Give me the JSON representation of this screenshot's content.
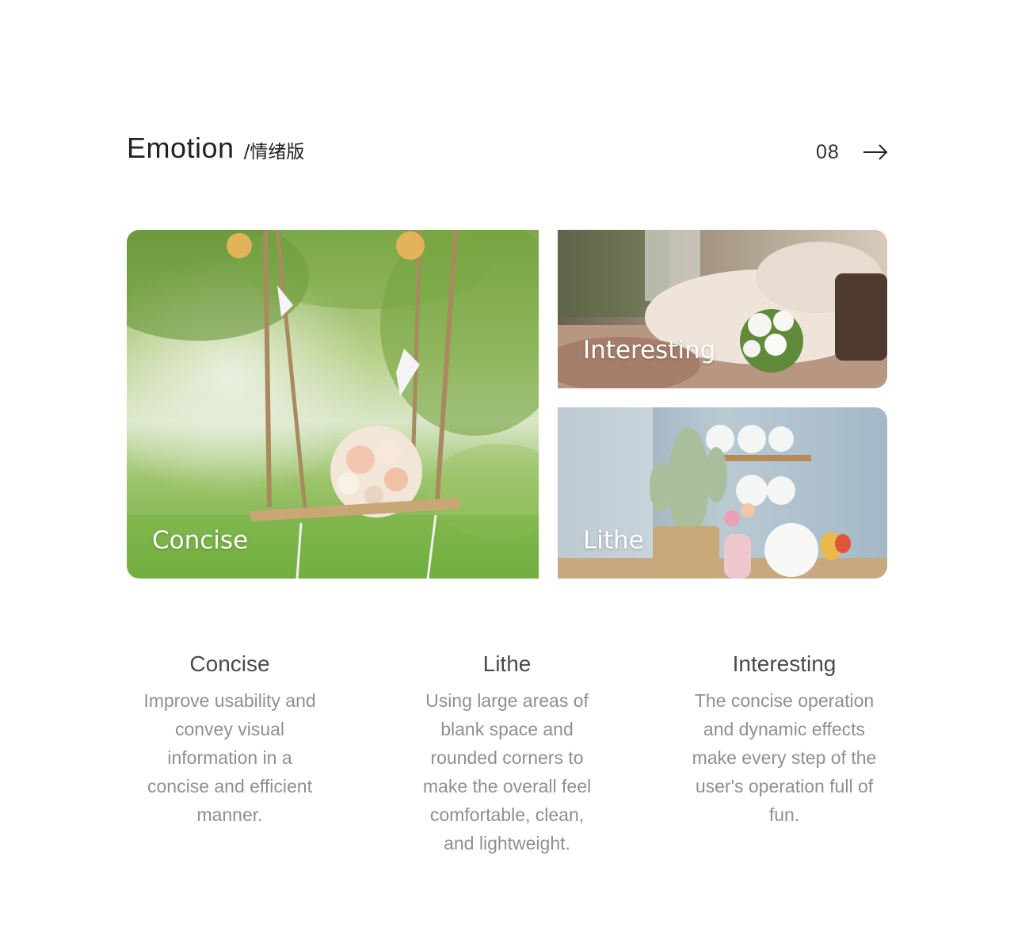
{
  "header": {
    "title": "Emotion",
    "subtitle": "/情绪版",
    "page_number": "08",
    "next_icon": "arrow-right-icon"
  },
  "tiles": [
    {
      "caption": "Concise",
      "image": "swing-with-flower-bouquet"
    },
    {
      "caption": "Interesting",
      "image": "sofa-with-orchid-bouquet"
    },
    {
      "caption": "Lithe",
      "image": "kitchen-with-fabric-cactus"
    }
  ],
  "features": [
    {
      "title": "Concise",
      "lines": [
        "Improve usability and",
        "convey visual",
        "information in a",
        "concise and efficient",
        "manner."
      ]
    },
    {
      "title": "Lithe",
      "lines": [
        "Using large areas of",
        "blank space and",
        "rounded corners to",
        "make the overall feel",
        "comfortable, clean,",
        "and lightweight."
      ]
    },
    {
      "title": "Interesting",
      "lines": [
        "The concise operation",
        "and dynamic effects",
        "make every step of the",
        "user's operation full of",
        "fun."
      ]
    }
  ],
  "colors": {
    "background": "#ffffff",
    "title": "#222222",
    "feature_title": "#4a4a4a",
    "feature_text": "#8f8f8f",
    "caption": "#ffffff"
  }
}
